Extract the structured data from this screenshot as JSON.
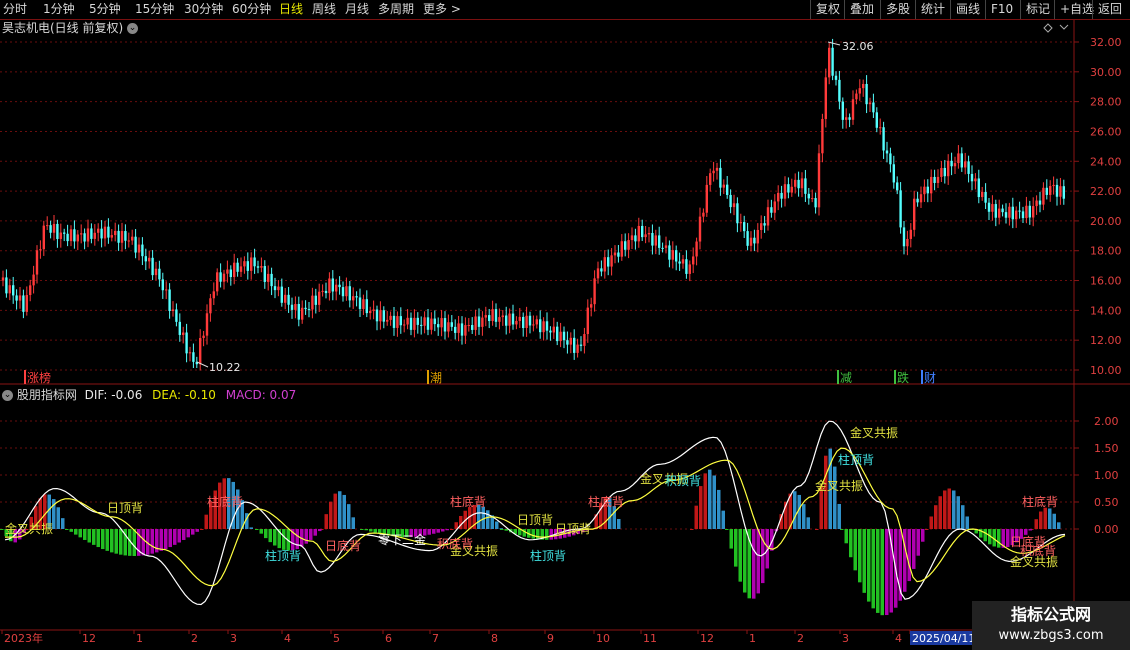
{
  "toolbar": {
    "left_items": [
      "分时",
      "1分钟",
      "5分钟",
      "15分钟",
      "30分钟",
      "60分钟",
      "日线",
      "周线",
      "月线",
      "多周期",
      "更多 >"
    ],
    "active_item": "日线",
    "right_items": [
      "复权",
      "叠加",
      "多股",
      "统计",
      "画线",
      "F10",
      "标记",
      "+自选",
      "返回"
    ]
  },
  "main_chart": {
    "title": "昊志机电(日线 前复权)",
    "price_axis": [
      "32.00",
      "30.00",
      "28.00",
      "26.00",
      "24.00",
      "22.00",
      "20.00",
      "18.00",
      "16.00",
      "14.00",
      "12.00",
      "10.00"
    ],
    "high_label": "32.06",
    "low_label": "10.22",
    "event_tags": [
      {
        "text": "涨榜",
        "color": "#ff4040"
      },
      {
        "text": "潮",
        "color": "#e0a000"
      },
      {
        "text": "减",
        "color": "#40c040"
      },
      {
        "text": "跌",
        "color": "#40c040"
      },
      {
        "text": "财",
        "color": "#4080ff"
      }
    ]
  },
  "indicator": {
    "name": "股朋指标网",
    "dif_label": "DIF: -0.06",
    "dea_label": "DEA: -0.10",
    "macd_label": "MACD: 0.07",
    "axis": [
      "2.00",
      "1.50",
      "1.00",
      "0.50",
      "0.00"
    ],
    "signals": [
      {
        "text": "柱顶背",
        "color": "#40e0e0"
      },
      {
        "text": "柱底背",
        "color": "#ff6060"
      },
      {
        "text": "日顶背",
        "color": "#e0e040"
      },
      {
        "text": "日底背",
        "color": "#ff6060"
      },
      {
        "text": "金叉共振",
        "color": "#e0e040"
      },
      {
        "text": "积顶背",
        "color": "#40e0e0"
      },
      {
        "text": "积底背",
        "color": "#ff6060"
      },
      {
        "text": "零下二金",
        "color": "#ffffff"
      }
    ]
  },
  "time_axis": {
    "labels": [
      "2023年",
      "12",
      "1",
      "2",
      "3",
      "4",
      "5",
      "6",
      "7",
      "8",
      "9",
      "10",
      "11",
      "12",
      "1",
      "2",
      "3",
      "4",
      "2025/04/11"
    ]
  },
  "watermark": {
    "title": "指标公式网",
    "url": "www.zbgs3.com"
  },
  "colors": {
    "up": "#ff3a3a",
    "down": "#54ffff",
    "grid": "#7a1010",
    "dif": "#ffffff",
    "dea": "#ffff40",
    "macd_neg_a": "#22c022",
    "macd_neg_b": "#b000b0"
  }
}
